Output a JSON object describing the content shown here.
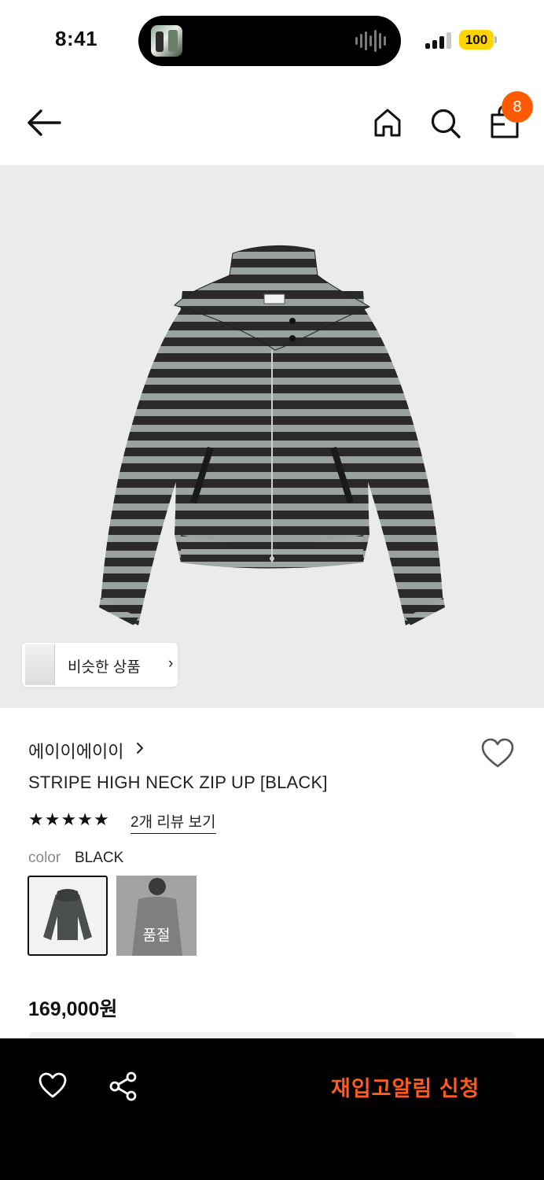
{
  "status_bar": {
    "time": "8:41",
    "battery": "100",
    "battery_color": "#ffd400"
  },
  "header": {
    "back_icon": "arrow-left-icon",
    "home_icon": "home-icon",
    "search_icon": "search-icon",
    "cart_icon": "shopping-bag-icon",
    "cart_count": "8",
    "badge_color": "#ff5a00"
  },
  "product": {
    "similar_label": "비슷한 상품",
    "similar_chevron": "›",
    "brand": "에이이에이이",
    "name": "STRIPE HIGH NECK ZIP UP [BLACK]",
    "rating_stars": 5,
    "review_link": "2개 리뷰 보기",
    "color_label": "color",
    "color_value": "BLACK",
    "swatches": [
      {
        "state": "selected"
      },
      {
        "state": "soldout",
        "label": "품절"
      }
    ],
    "price": "169,000원"
  },
  "bottom_bar": {
    "wishlist_icon": "heart-icon",
    "share_icon": "share-icon",
    "restock_label": "재입고알림 신청",
    "accent_color": "#ff5a1f"
  }
}
